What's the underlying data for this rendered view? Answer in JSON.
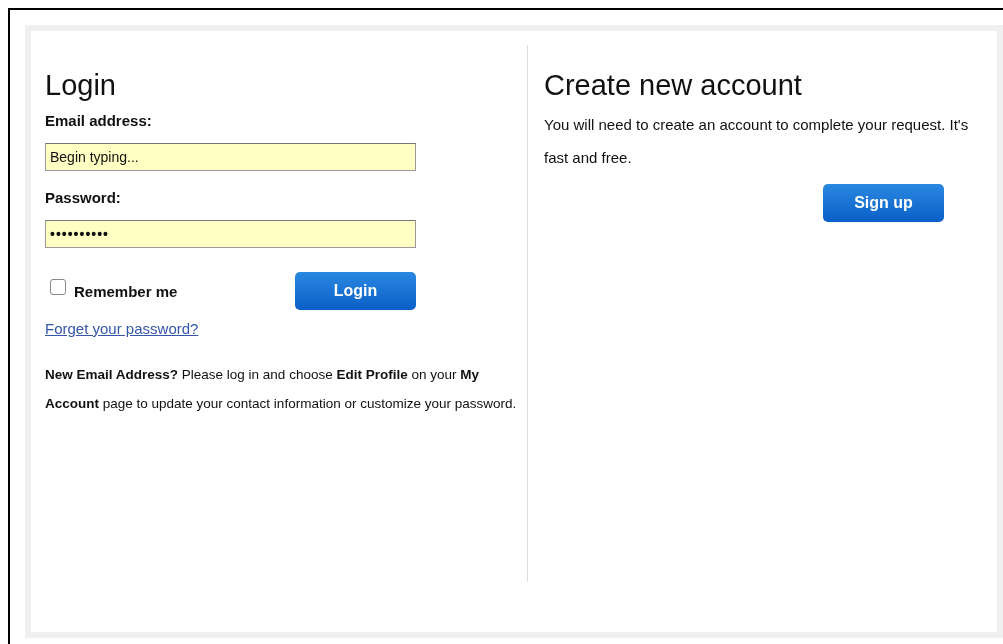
{
  "login": {
    "title": "Login",
    "email": {
      "label": "Email address:",
      "value": "Begin typing..."
    },
    "password": {
      "label": "Password:",
      "value": "••••••••••"
    },
    "remember": {
      "label": "Remember me",
      "checked": false
    },
    "button": "Login",
    "forgot_link": "Forget your password?",
    "note": "**New Email Address?** Please log in and choose **Edit Profile** on your **My Account** page to update your contact information or customize your password."
  },
  "create": {
    "title": "Create new account",
    "text": "You will need to create an account to complete your request. It's fast and free.",
    "button": "Sign up"
  }
}
